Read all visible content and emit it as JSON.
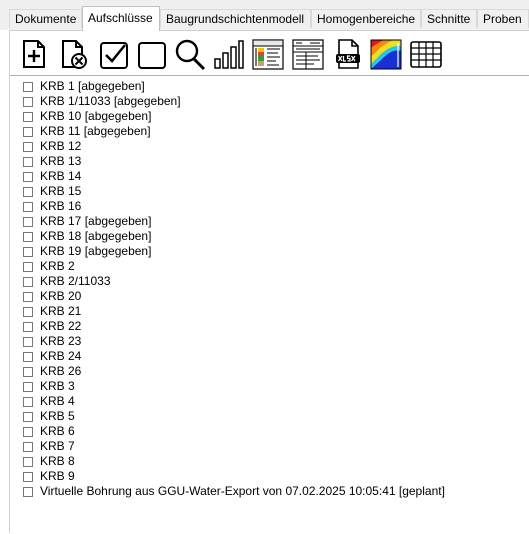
{
  "tabs": [
    {
      "label": "Dokumente"
    },
    {
      "label": "Aufschlüsse"
    },
    {
      "label": "Baugrundschichtenmodell"
    },
    {
      "label": "Homogenbereiche"
    },
    {
      "label": "Schnitte"
    },
    {
      "label": "Proben"
    }
  ],
  "active_tab": "Aufschlüsse",
  "toolbar": [
    {
      "icon": "add-document-icon"
    },
    {
      "icon": "delete-document-icon"
    },
    {
      "icon": "check-all-icon"
    },
    {
      "icon": "uncheck-all-icon"
    },
    {
      "icon": "search-icon"
    },
    {
      "icon": "bar-chart-icon"
    },
    {
      "icon": "borehole-profile-icon"
    },
    {
      "icon": "ggu-report-icon"
    },
    {
      "icon": "xlsx-export-icon"
    },
    {
      "icon": "contour-map-icon"
    },
    {
      "icon": "table-icon"
    }
  ],
  "items": [
    {
      "label": "KRB 1 [abgegeben]"
    },
    {
      "label": "KRB 1/11033 [abgegeben]"
    },
    {
      "label": "KRB 10 [abgegeben]"
    },
    {
      "label": "KRB 11 [abgegeben]"
    },
    {
      "label": "KRB 12"
    },
    {
      "label": "KRB 13"
    },
    {
      "label": "KRB 14"
    },
    {
      "label": "KRB 15"
    },
    {
      "label": "KRB 16"
    },
    {
      "label": "KRB 17 [abgegeben]"
    },
    {
      "label": "KRB 18 [abgegeben]"
    },
    {
      "label": "KRB 19 [abgegeben]"
    },
    {
      "label": "KRB 2"
    },
    {
      "label": "KRB 2/11033"
    },
    {
      "label": "KRB 20"
    },
    {
      "label": "KRB 21"
    },
    {
      "label": "KRB 22"
    },
    {
      "label": "KRB 23"
    },
    {
      "label": "KRB 24"
    },
    {
      "label": "KRB 26"
    },
    {
      "label": "KRB 3"
    },
    {
      "label": "KRB 4"
    },
    {
      "label": "KRB 5"
    },
    {
      "label": "KRB 6"
    },
    {
      "label": "KRB 7"
    },
    {
      "label": "KRB 8"
    },
    {
      "label": "KRB 9"
    },
    {
      "label": "Virtuelle Bohrung aus GGU-Water-Export von 07.02.2025 10:05:41 [geplant]"
    }
  ]
}
